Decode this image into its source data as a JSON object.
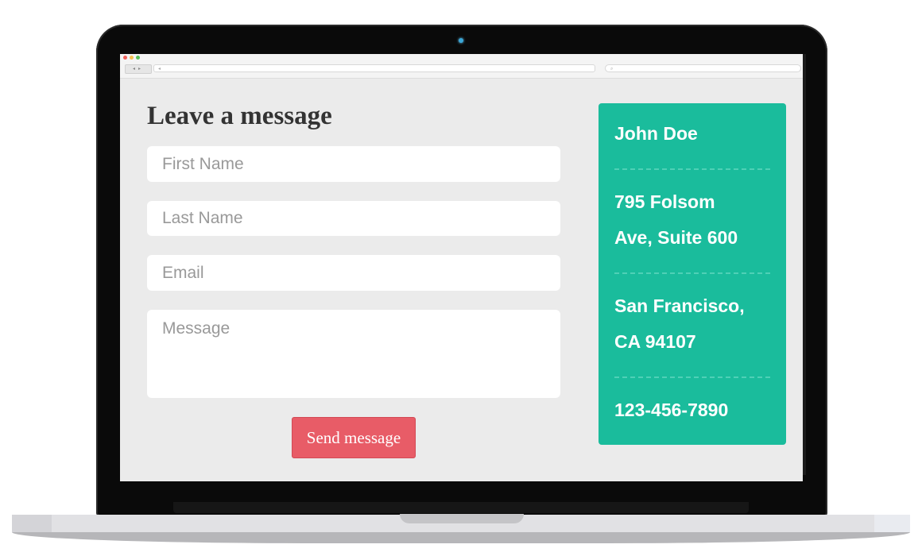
{
  "form": {
    "title": "Leave a message",
    "fields": {
      "first_name": {
        "placeholder": "First Name",
        "value": ""
      },
      "last_name": {
        "placeholder": "Last Name",
        "value": ""
      },
      "email": {
        "placeholder": "Email",
        "value": ""
      },
      "message": {
        "placeholder": "Message",
        "value": ""
      }
    },
    "send_label": "Send message"
  },
  "contact": {
    "name": "John Doe",
    "address_line1": "795 Folsom",
    "address_line2": "Ave, Suite 600",
    "city_line1": "San Francisco,",
    "city_line2": "CA 94107",
    "phone": "123-456-7890"
  },
  "colors": {
    "accent": "#1abc9c",
    "button": "#e85c67",
    "background": "#ebebeb"
  }
}
